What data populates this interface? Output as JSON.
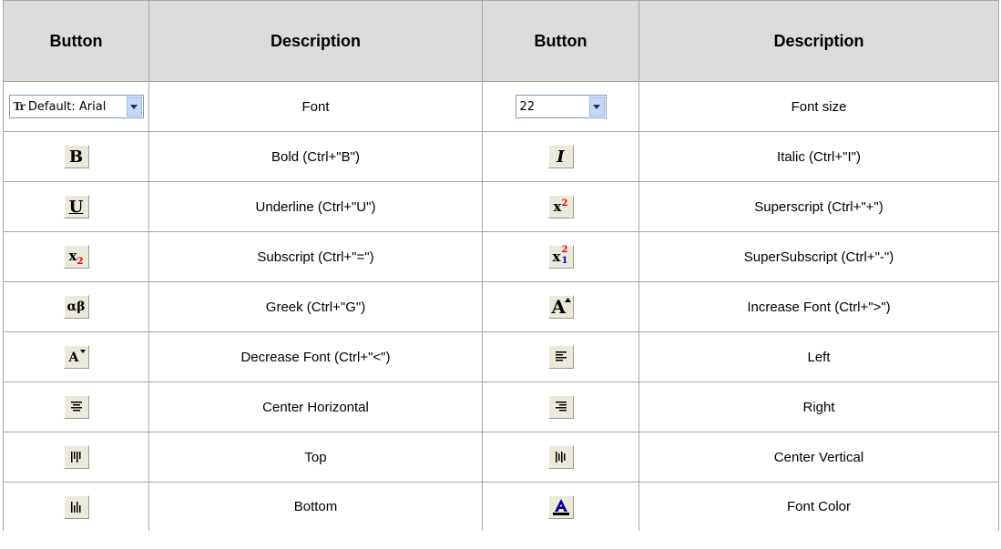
{
  "headers": [
    "Button",
    "Description",
    "Button",
    "Description"
  ],
  "font_combo": {
    "icon": "truetype-font-icon",
    "value": "Default: Arial"
  },
  "size_combo": {
    "value": "22"
  },
  "rows": [
    {
      "left_icon": "font-combo",
      "left_desc": "Font",
      "right_icon": "font-size-combo",
      "right_desc": "Font size"
    },
    {
      "left_icon": "bold-icon",
      "left_desc": "Bold (Ctrl+\"B\")",
      "right_icon": "italic-icon",
      "right_desc": "Italic (Ctrl+\"I\")"
    },
    {
      "left_icon": "underline-icon",
      "left_desc": "Underline (Ctrl+\"U\")",
      "right_icon": "superscript-icon",
      "right_desc": "Superscript (Ctrl+\"+\")"
    },
    {
      "left_icon": "subscript-icon",
      "left_desc": "Subscript (Ctrl+\"=\")",
      "right_icon": "supersubscript-icon",
      "right_desc": "SuperSubscript (Ctrl+\"-\")"
    },
    {
      "left_icon": "greek-icon",
      "left_desc": "Greek (Ctrl+\"G\")",
      "right_icon": "increase-font-icon",
      "right_desc": "Increase Font (Ctrl+\">\")"
    },
    {
      "left_icon": "decrease-font-icon",
      "left_desc": "Decrease Font (Ctrl+\"<\")",
      "right_icon": "align-left-icon",
      "right_desc": "Left"
    },
    {
      "left_icon": "align-center-icon",
      "left_desc": "Center Horizontal",
      "right_icon": "align-right-icon",
      "right_desc": "Right"
    },
    {
      "left_icon": "align-top-icon",
      "left_desc": "Top",
      "right_icon": "align-center-vertical-icon",
      "right_desc": "Center Vertical"
    },
    {
      "left_icon": "align-bottom-icon",
      "left_desc": "Bottom",
      "right_icon": "font-color-icon",
      "right_desc": "Font Color"
    }
  ],
  "glyphs": {
    "bold": "B",
    "italic": "I",
    "underline": "U",
    "base": "x",
    "sup": "2",
    "sub": "2",
    "subsub": "1",
    "greek": "αβ",
    "font_a": "A"
  },
  "colors": {
    "header_bg": "#dcdcdc",
    "border": "#a6a6a6",
    "button_bg": "#ebe9dc",
    "combo_arrow": "#c6d8f8",
    "script_red": "#e00000",
    "script_blue": "#0000d0",
    "font_color_blue": "#0000a0"
  }
}
